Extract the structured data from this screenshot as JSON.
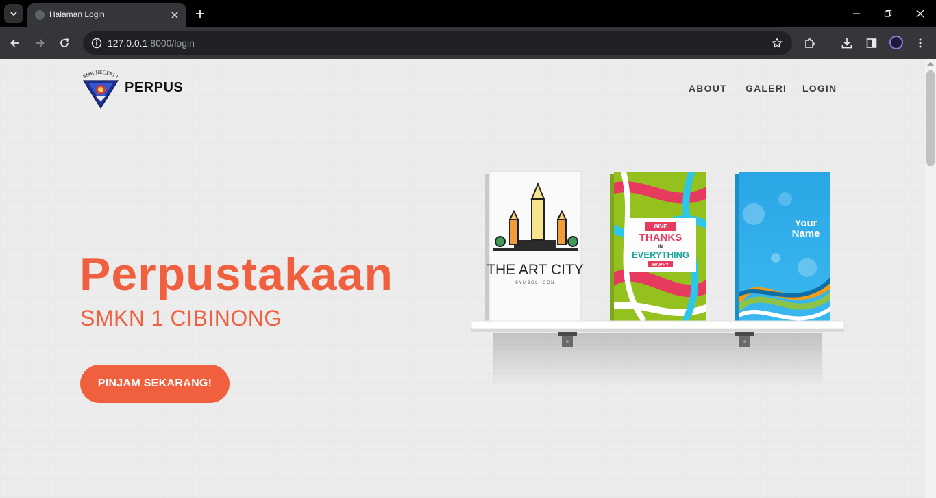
{
  "browser": {
    "tab_title": "Halaman Login",
    "url_host": "127.0.0.1",
    "url_path": ":8000/login"
  },
  "site": {
    "brand": "PERPUS",
    "logo_caption": "SMK NEGERI 1",
    "nav": [
      "ABOUT",
      "GALERI",
      "LOGIN"
    ]
  },
  "hero": {
    "title": "Perpustakaan",
    "subtitle": "SMKN 1 CIBINONG",
    "cta": "PINJAM SEKARANG!"
  },
  "books": [
    {
      "title": "THE ART CITY",
      "subtitle": "SYMBOL ICON"
    },
    {
      "line1": "GIVE",
      "line2": "THANKS",
      "line3": "IN",
      "line4": "EVERYTHING",
      "line5": "HAPPY"
    },
    {
      "line1": "Your",
      "line2": "Name"
    }
  ],
  "colors": {
    "accent": "#f0603f",
    "page_bg": "#ececec",
    "browser_dark": "#202124"
  },
  "icons": {
    "tab_search": "chevron-down-icon",
    "close": "close-icon",
    "new_tab": "plus-icon",
    "back": "arrow-left-icon",
    "forward": "arrow-right-icon",
    "reload": "reload-icon",
    "info": "info-icon",
    "bookmark": "star-icon",
    "extensions": "puzzle-icon",
    "download": "download-icon",
    "side_panel": "side-panel-icon",
    "menu": "kebab-menu-icon"
  }
}
